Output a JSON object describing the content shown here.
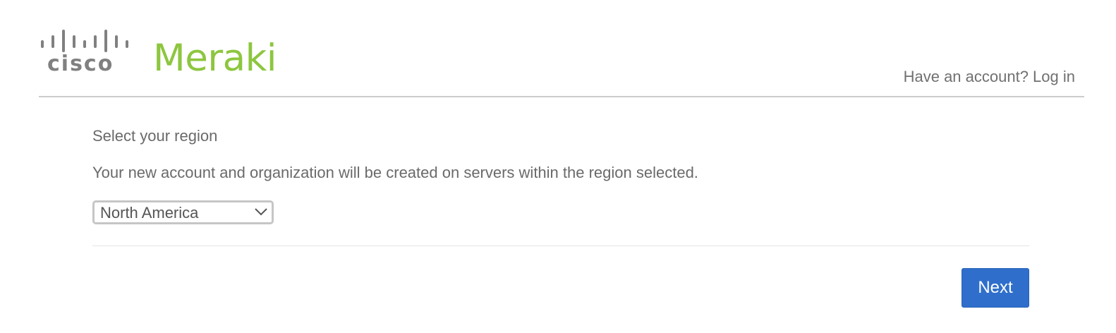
{
  "header": {
    "cisco_logo_text": "cisco",
    "brand_name": "Meraki",
    "login_link": "Have an account? Log in"
  },
  "region_step": {
    "title": "Select your region",
    "description": "Your new account and organization will be created on servers within the region selected.",
    "region_select": {
      "selected_value": "North America"
    },
    "next_button_label": "Next"
  },
  "colors": {
    "brand_green": "#8dc63f",
    "cisco_gray": "#808080",
    "primary_button": "#2f6fcb"
  },
  "icons": [
    "cisco-bars-icon",
    "chevron-down-icon"
  ]
}
